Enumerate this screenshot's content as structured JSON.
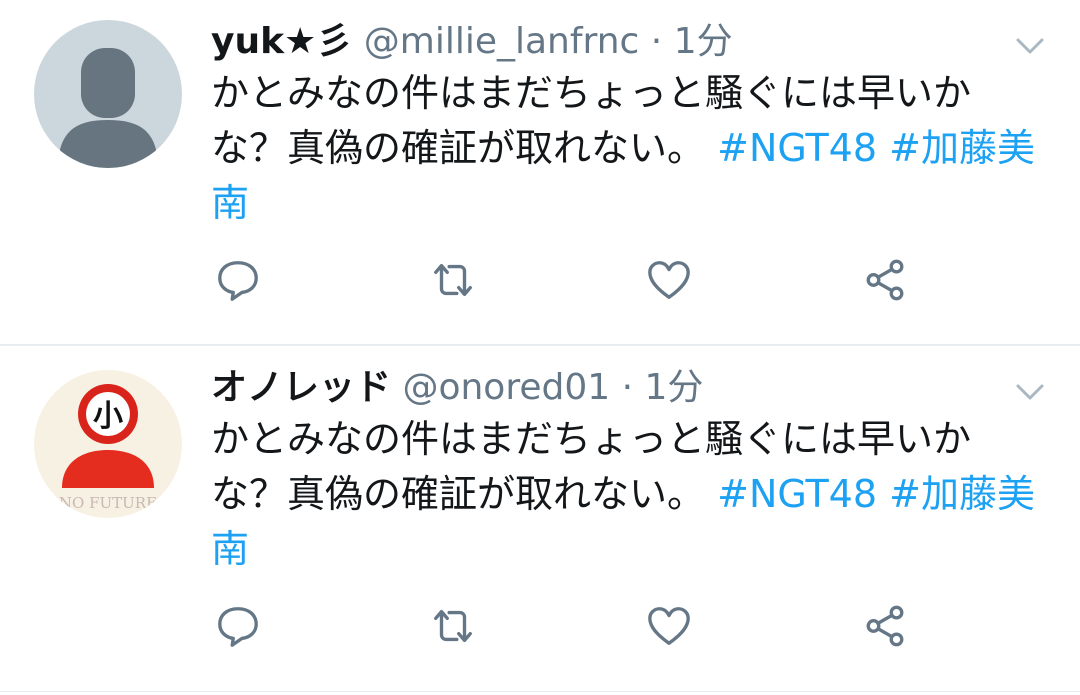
{
  "tweets": [
    {
      "name": "yuk★彡",
      "handle": "@millie_lanfrnc",
      "separator": "·",
      "time": "1分",
      "text": "かとみなの件はまだちょっと騒ぐには早いかな？真偽の確証が取れない。",
      "hashtags": [
        "#NGT48",
        "#加藤美南"
      ],
      "avatar": "default-avatar-icon"
    },
    {
      "name": "オノレッド",
      "handle": "@onored01",
      "separator": "·",
      "time": "1分",
      "text": "かとみなの件はまだちょっと騒ぐには早いかな？真偽の確証が取れない。",
      "hashtags": [
        "#NGT48",
        "#加藤美南"
      ],
      "avatar": "no-future-avatar",
      "avatar_text": {
        "badge": "小",
        "caption": "NO FUTURE"
      }
    }
  ],
  "colors": {
    "accent": "#1da1f2",
    "muted": "#657786",
    "text": "#14171a",
    "divider": "#e6ecf0"
  },
  "icons": [
    "reply-icon",
    "retweet-icon",
    "like-icon",
    "share-icon",
    "chevron-down-icon"
  ]
}
